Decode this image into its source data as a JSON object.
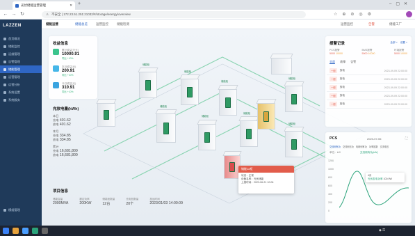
{
  "browser": {
    "tab_title": "光伏储能运营管理",
    "url": "不安全 | 172.23.51.251:21032/#/storage/energy/overview"
  },
  "header": {
    "site_select": "储能运营",
    "crumbs": [
      "储能总览",
      "运营监控",
      "储能检测"
    ],
    "right_items": [
      "运营监控",
      "告警",
      "储能工厂"
    ]
  },
  "sidebar": {
    "logo": "LAZZEN",
    "items": [
      {
        "label": "首页概况"
      },
      {
        "label": "储能监控"
      },
      {
        "label": "运维管理"
      },
      {
        "label": "告警管理"
      },
      {
        "label": "储能管理"
      },
      {
        "label": "运营管理"
      },
      {
        "label": "运营分析"
      },
      {
        "label": "系统设置"
      },
      {
        "label": "系统服务"
      }
    ],
    "bottom_label": "模组管理"
  },
  "income": {
    "title": "收益信息",
    "rows": [
      {
        "label": "累计收益(万元)",
        "value": "10000.91",
        "sub": "同比 +10%"
      },
      {
        "label": "本月收益(元)",
        "value": "200.91",
        "sub": "同比 +10%"
      },
      {
        "label": "今日收益(元)",
        "value": "310.91",
        "sub": "同比 +10%"
      }
    ]
  },
  "energy": {
    "title": "充放电量(kWh)",
    "groups": [
      {
        "label": "本日",
        "charge": "401.62",
        "discharge": "401.62"
      },
      {
        "label": "本月",
        "charge": "334.85",
        "discharge": "334.85"
      },
      {
        "label": "累计",
        "charge": "16,681,800",
        "discharge": "16,681,800"
      }
    ],
    "charge_label": "充电",
    "discharge_label": "放电"
  },
  "project": {
    "title": "项目信息",
    "items": [
      {
        "label": "储能容量",
        "value": "2000MVA"
      },
      {
        "label": "额定功率",
        "value": "200KW"
      },
      {
        "label": "储能柜数量",
        "value": "12台"
      },
      {
        "label": "充电桩数量",
        "value": "20个"
      },
      {
        "label": "投运时间",
        "value": "2023/01/03 14:00:09"
      }
    ]
  },
  "alerts_panel": {
    "title": "报警记录",
    "links": [
      "全部 >",
      "设置 >"
    ],
    "counters": [
      {
        "label": "PCS报警",
        "value": "5000",
        "sub": "10000"
      },
      {
        "label": "BMS报警",
        "value": "5000",
        "sub": "10000"
      },
      {
        "label": "环境报警",
        "value": "5000",
        "sub": "10000"
      }
    ],
    "tabs": [
      "全部",
      "故障",
      "告警"
    ],
    "records": [
      {
        "tag": "一般",
        "name": "放电",
        "time": "2023-09-09 22:00:00"
      },
      {
        "tag": "一般",
        "name": "放电",
        "time": "2023-09-09 22:00:00"
      },
      {
        "tag": "一般",
        "name": "放电",
        "time": "2023-09-09 22:00:00"
      },
      {
        "tag": "一般",
        "name": "放电",
        "time": "2023-09-09 22:00:00"
      },
      {
        "tag": "一般",
        "name": "放电",
        "time": "2023-09-09 22:00:00"
      }
    ]
  },
  "pcs": {
    "title": "PCS",
    "date": "2023-07-06",
    "tabs": [
      "交流侧有功",
      "交流侧无功",
      "电网侧有功",
      "功率因数",
      "交流电压",
      "交流电流"
    ],
    "unit": "单位：kW",
    "legend": "交流侧有功(kW)",
    "tooltip": {
      "date": "4月",
      "label": "光伏发电功率",
      "value": "100.9W"
    },
    "y_ticks": [
      "1200",
      "1000",
      "800",
      "600",
      "400",
      "200",
      "0"
    ]
  },
  "fault_popup": {
    "title": "储能1#柜",
    "rows": [
      {
        "k": "状态",
        "v": "正常"
      },
      {
        "k": "设备名称",
        "v": "光伏储能"
      },
      {
        "k": "上报时间",
        "v": "2023-06-21 10:06"
      }
    ]
  },
  "cabinet_labels": [
    "储能柜",
    "储能柜",
    "储能柜",
    "储能柜",
    "储能柜",
    "储能柜",
    "储能柜",
    "储能柜"
  ],
  "colors": {
    "accent": "#2f66c4",
    "sidebar": "#1f3a5a",
    "green": "#3bc48d",
    "alert_red": "#e25c4b"
  }
}
